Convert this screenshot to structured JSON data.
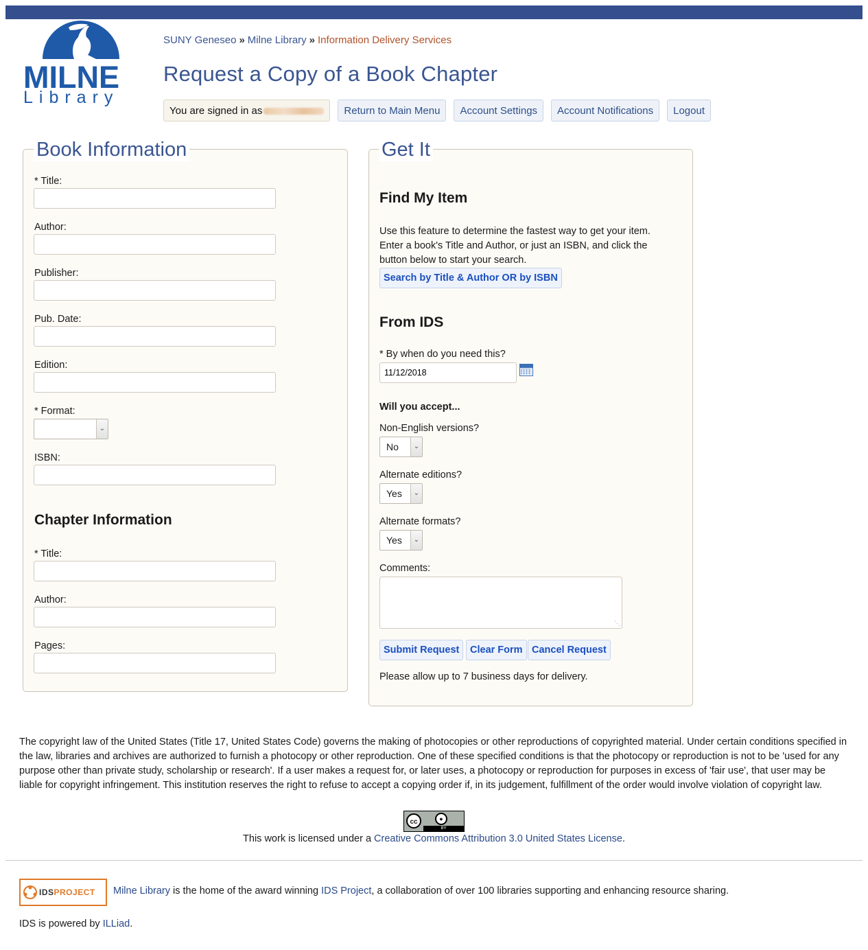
{
  "logo": {
    "line1": "MILNE",
    "line2": "Library"
  },
  "breadcrumb": {
    "item1": "SUNY Geneseo",
    "item2": "Milne Library",
    "current": "Information Delivery Services",
    "separator": "»"
  },
  "page_title": "Request a Copy of a Book Chapter",
  "nav": {
    "signed_in": "You are signed in as",
    "main_menu": "Return to Main Menu",
    "account_settings": "Account Settings",
    "account_notifications": "Account Notifications",
    "logout": "Logout"
  },
  "book_info": {
    "legend": "Book Information",
    "title_label": "* Title:",
    "author_label": "Author:",
    "publisher_label": "Publisher:",
    "pubdate_label": "Pub. Date:",
    "edition_label": "Edition:",
    "format_label": "* Format:",
    "format_value": "",
    "isbn_label": "ISBN:"
  },
  "chapter_info": {
    "heading": "Chapter Information",
    "title_label": "* Title:",
    "author_label": "Author:",
    "pages_label": "Pages:"
  },
  "get_it": {
    "legend": "Get It",
    "find_heading": "Find My Item",
    "find_text": "Use this feature to determine the fastest way to get your item. Enter a book's Title and Author, or just an ISBN, and click the button below to start your search.",
    "search_button": "Search by Title & Author OR by ISBN",
    "from_ids_heading": "From IDS",
    "need_by_label": "* By when do you need this?",
    "need_by_value": "11/12/2018",
    "accept_heading": "Will you accept...",
    "non_english_label": "Non-English versions?",
    "non_english_value": "No",
    "alt_editions_label": "Alternate editions?",
    "alt_editions_value": "Yes",
    "alt_formats_label": "Alternate formats?",
    "alt_formats_value": "Yes",
    "comments_label": "Comments:",
    "submit": "Submit Request",
    "clear": "Clear Form",
    "cancel": "Cancel Request",
    "delivery_note": "Please allow up to 7 business days for delivery."
  },
  "copyright_text": "The copyright law of the United States (Title 17, United States Code) governs the making of photocopies or other reproductions of copyrighted material. Under certain conditions specified in the law, libraries and archives are authorized to furnish a photocopy or other reproduction. One of these specified conditions is that the photocopy or reproduction is not to be 'used for any purpose other than private study, scholarship or research'. If a user makes a request for, or later uses, a photocopy or reproduction for purposes in excess of 'fair use', that user may be liable for copyright infringement. This institution reserves the right to refuse to accept a copying order if, in its judgement, fulfillment of the order would involve violation of copyright law.",
  "cc": {
    "cc": "cc",
    "by": "BY",
    "license_prefix": "This work is licensed under a",
    "license_link": "Creative Commons Attribution 3.0 United States License",
    "license_suffix": "."
  },
  "footer": {
    "ids_logo_a": "IDS",
    "ids_logo_b": "PROJECT",
    "milne_link": "Milne Library",
    "text1": "is the home of the award winning",
    "ids_link": "IDS Project",
    "text2": ", a collaboration of over 100 libraries supporting and enhancing resource sharing.",
    "powered_prefix": "IDS is powered by",
    "illiad_link": "ILLiad",
    "powered_suffix": "."
  },
  "colors": {
    "brand_blue": "#354f8e",
    "link_blue": "#3a5591",
    "accent_orange": "#b0532c",
    "panel_bg": "#fdfbf6"
  }
}
